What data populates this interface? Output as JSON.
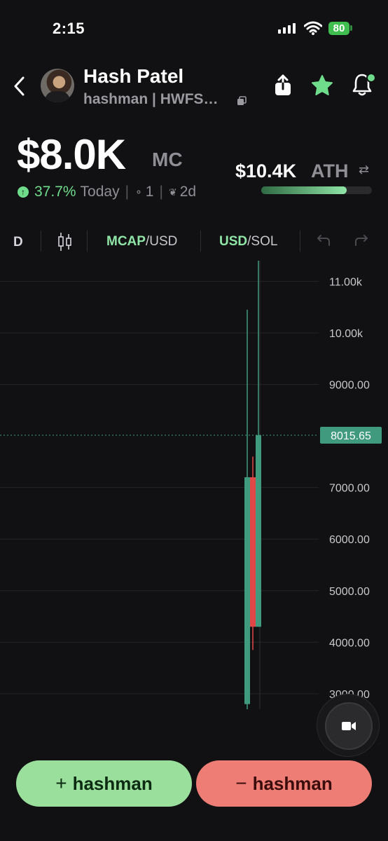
{
  "status_bar": {
    "time": "2:15",
    "battery": "80"
  },
  "header": {
    "name": "Hash Patel",
    "subtitle": "hashman | HWFS…",
    "icons": [
      "back-icon",
      "share-icon",
      "star-icon",
      "bell-icon",
      "copy-icon"
    ],
    "star_color": "#6fdc8c"
  },
  "price": {
    "value": "$8.0K",
    "unit": "MC",
    "change_pct": "37.7%",
    "change_label": "Today",
    "holders": "1",
    "age": "2d",
    "ath_value": "$10.4K",
    "ath_label": "ATH",
    "ath_progress": 0.77
  },
  "toolbar": {
    "interval": "D",
    "mcap_label": "MCAP",
    "mcap_suffix": "/USD",
    "usd_label": "USD",
    "usd_suffix": "/SOL"
  },
  "chart_data": {
    "type": "candlestick",
    "y_ticks": [
      "11.00k",
      "10.00k",
      "9000.00",
      "8000.00",
      "7000.00",
      "6000.00",
      "5000.00",
      "4000.00",
      "3000.00"
    ],
    "ylim": [
      2700,
      11400
    ],
    "current_price": "8015.65",
    "candles": [
      {
        "open": 2800,
        "close": 7200,
        "high": 10450,
        "low": 2700,
        "color": "green"
      },
      {
        "open": 7200,
        "close": 4300,
        "high": 7600,
        "low": 3850,
        "color": "red"
      },
      {
        "open": 4300,
        "close": 8015.65,
        "high": 11400,
        "low": 4300,
        "color": "green"
      }
    ],
    "colors": {
      "up": "#3f9a7e",
      "down": "#e04848",
      "price_tag": "#3f9a7e"
    }
  },
  "actions": {
    "buy_label": "hashman",
    "sell_label": "hashman",
    "buy_color": "#9ae09c",
    "sell_color": "#ee7e75"
  }
}
